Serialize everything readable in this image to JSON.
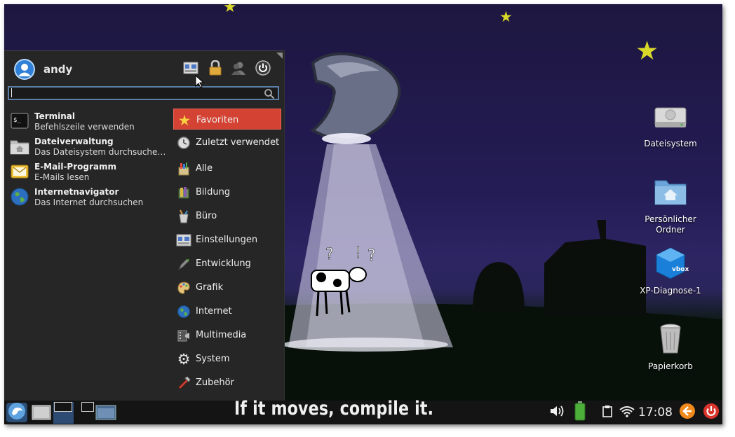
{
  "menu": {
    "user_name": "andy",
    "search": {
      "value": "",
      "placeholder": ""
    },
    "favorites": [
      {
        "title": "Terminal",
        "subtitle": "Befehlszeile verwenden",
        "icon": "terminal-icon"
      },
      {
        "title": "Dateiverwaltung",
        "subtitle": "Das Dateisystem durchsuche…",
        "icon": "folder-home-icon"
      },
      {
        "title": "E-Mail-Programm",
        "subtitle": "E-Mails lesen",
        "icon": "mail-icon"
      },
      {
        "title": "Internetnavigator",
        "subtitle": "Das Internet durchsuchen",
        "icon": "globe-icon"
      }
    ],
    "categories": [
      {
        "label": "Favoriten",
        "icon": "star-icon",
        "selected": true
      },
      {
        "label": "Zuletzt verwendet",
        "icon": "recent-icon"
      },
      {
        "label": "Alle",
        "icon": "all-apps-icon"
      },
      {
        "label": "Bildung",
        "icon": "education-icon"
      },
      {
        "label": "Büro",
        "icon": "office-icon"
      },
      {
        "label": "Einstellungen",
        "icon": "settings-icon"
      },
      {
        "label": "Entwicklung",
        "icon": "development-icon"
      },
      {
        "label": "Grafik",
        "icon": "graphics-icon"
      },
      {
        "label": "Internet",
        "icon": "internet-icon"
      },
      {
        "label": "Multimedia",
        "icon": "multimedia-icon"
      },
      {
        "label": "System",
        "icon": "system-gear-icon"
      },
      {
        "label": "Zubehör",
        "icon": "accessories-icon"
      }
    ]
  },
  "desktop": {
    "icons": [
      {
        "label": "Dateisystem",
        "icon": "harddisk-icon"
      },
      {
        "label": "Persönlicher\nOrdner",
        "icon": "home-folder-icon"
      },
      {
        "label": "XP-Diagnose-1",
        "icon": "virtualbox-icon"
      },
      {
        "label": "Papierkorb",
        "icon": "trash-icon"
      }
    ]
  },
  "panel": {
    "motto": "If it moves, compile it.",
    "clock": "17:08"
  },
  "colors": {
    "accent_selected": "#d44233",
    "menu_bg": "#262626",
    "panel_bg": "#141414",
    "search_border": "#5a7ea6"
  }
}
